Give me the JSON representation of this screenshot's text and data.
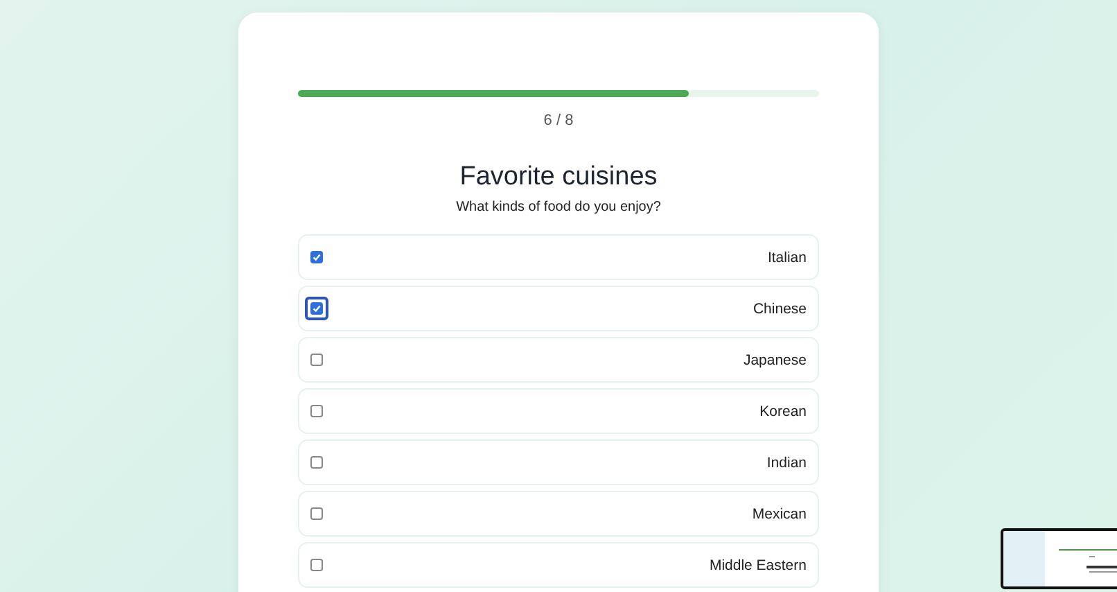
{
  "progress": {
    "level": 0.75,
    "counter": "6 / 8"
  },
  "question": {
    "title": "Favorite cuisines",
    "subtitle": "What kinds of food do you enjoy?"
  },
  "options": [
    {
      "label": "Italian",
      "checked": true,
      "focused": false
    },
    {
      "label": "Chinese",
      "checked": true,
      "focused": true
    },
    {
      "label": "Japanese",
      "checked": false,
      "focused": false
    },
    {
      "label": "Korean",
      "checked": false,
      "focused": false
    },
    {
      "label": "Indian",
      "checked": false,
      "focused": false
    },
    {
      "label": "Mexican",
      "checked": false,
      "focused": false
    },
    {
      "label": "Middle Eastern",
      "checked": false,
      "focused": false
    }
  ]
}
